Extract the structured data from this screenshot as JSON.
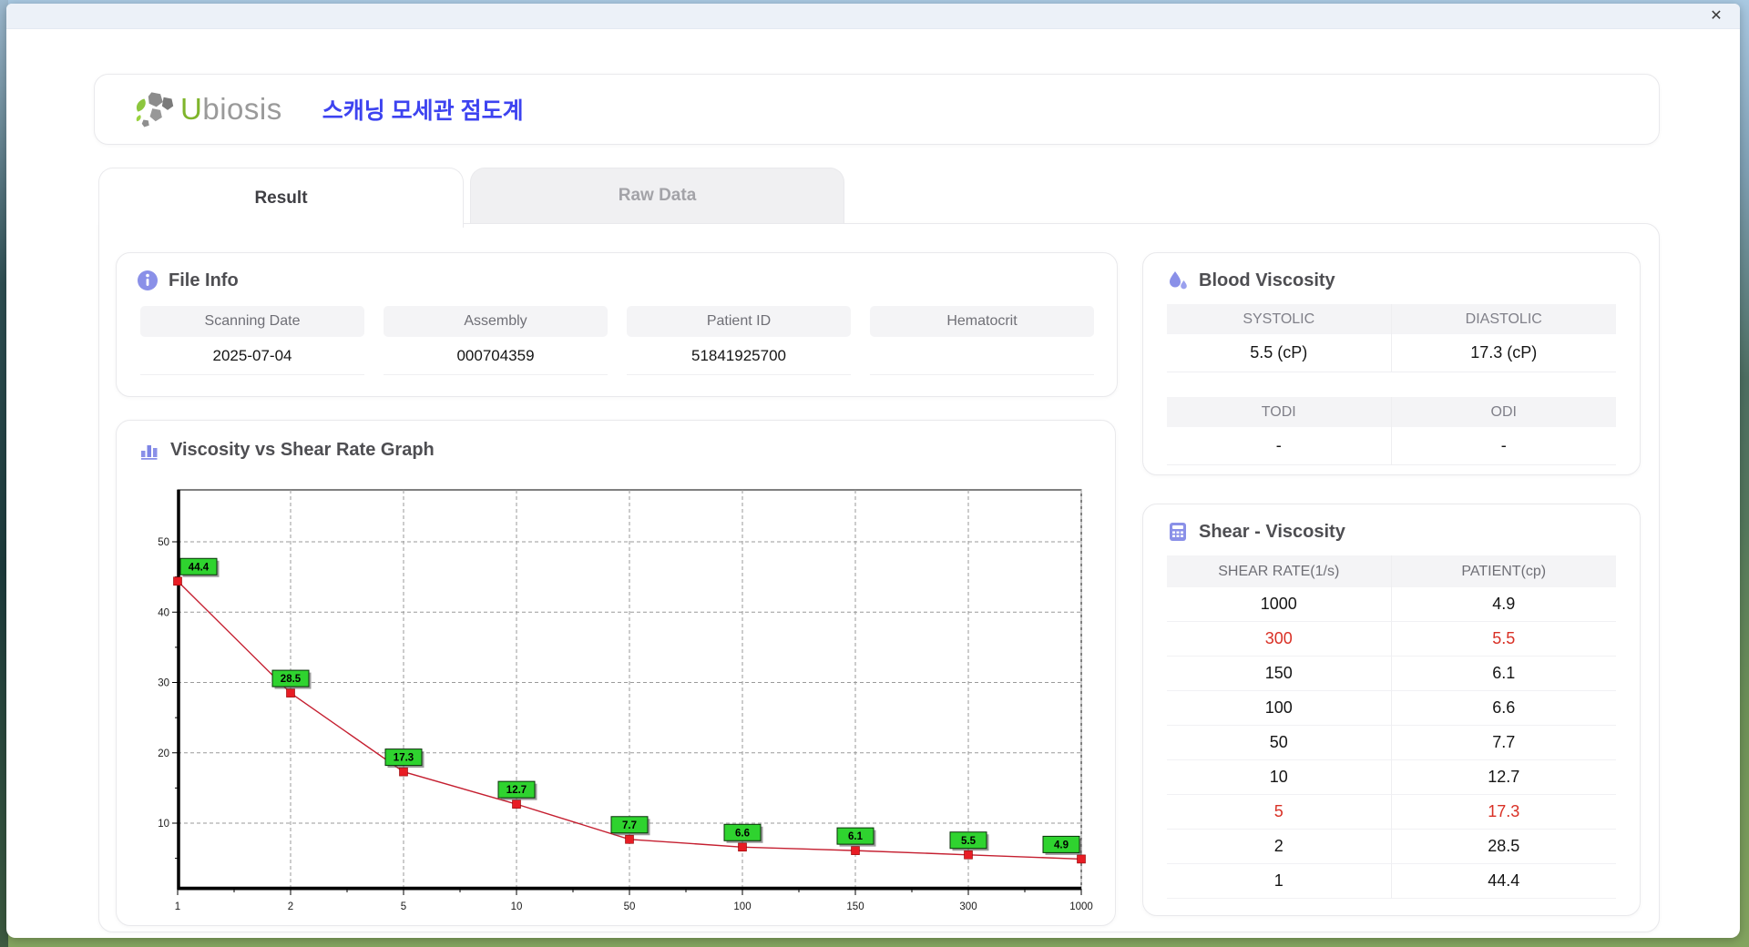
{
  "window": {
    "close_label": "✕"
  },
  "header": {
    "logo_u": "U",
    "logo_rest": "biosis",
    "app_title": "스캐닝 모세관 점도계"
  },
  "tabs": [
    {
      "label": "Result",
      "active": true
    },
    {
      "label": "Raw Data",
      "active": false
    }
  ],
  "file_info": {
    "title": "File Info",
    "fields": [
      {
        "label": "Scanning Date",
        "value": "2025-07-04"
      },
      {
        "label": "Assembly",
        "value": "000704359"
      },
      {
        "label": "Patient ID",
        "value": "51841925700"
      },
      {
        "label": "Hematocrit",
        "value": ""
      }
    ]
  },
  "blood_viscosity": {
    "title": "Blood Viscosity",
    "rows": [
      {
        "labels": [
          "SYSTOLIC",
          "DIASTOLIC"
        ],
        "values": [
          "5.5 (cP)",
          "17.3 (cP)"
        ]
      },
      {
        "labels": [
          "TODI",
          "ODI"
        ],
        "values": [
          "-",
          "-"
        ]
      }
    ]
  },
  "graph": {
    "title": "Viscosity vs Shear Rate Graph"
  },
  "chart_data": {
    "type": "line",
    "title": "Viscosity vs Shear Rate Graph",
    "x_scale": "categorical",
    "x_categories": [
      "1",
      "2",
      "5",
      "10",
      "50",
      "100",
      "150",
      "300",
      "1000"
    ],
    "series": [
      {
        "name": "PATIENT(cp)",
        "values": [
          44.4,
          28.5,
          17.3,
          12.7,
          7.7,
          6.6,
          6.1,
          5.5,
          4.9
        ]
      }
    ],
    "point_labels": [
      "44.4",
      "28.5",
      "17.3",
      "12.7",
      "7.7",
      "6.6",
      "6.1",
      "5.5",
      "4.9"
    ],
    "y_ticks": [
      10,
      20,
      30,
      40,
      50
    ],
    "ylim": [
      0,
      57
    ],
    "grid": true,
    "legend": false,
    "colors": {
      "line": "#c51f30",
      "marker": "#e81c24",
      "label_bg": "#2fd32f",
      "label_text": "#000000",
      "grid": "#9a9a9a"
    }
  },
  "shear_table": {
    "title": "Shear - Viscosity",
    "columns": [
      "SHEAR RATE(1/s)",
      "PATIENT(cp)"
    ],
    "rows": [
      {
        "shear": "1000",
        "patient": "4.9",
        "highlight": false
      },
      {
        "shear": "300",
        "patient": "5.5",
        "highlight": true
      },
      {
        "shear": "150",
        "patient": "6.1",
        "highlight": false
      },
      {
        "shear": "100",
        "patient": "6.6",
        "highlight": false
      },
      {
        "shear": "50",
        "patient": "7.7",
        "highlight": false
      },
      {
        "shear": "10",
        "patient": "12.7",
        "highlight": false
      },
      {
        "shear": "5",
        "patient": "17.3",
        "highlight": true
      },
      {
        "shear": "2",
        "patient": "28.5",
        "highlight": false
      },
      {
        "shear": "1",
        "patient": "44.4",
        "highlight": false
      }
    ]
  }
}
